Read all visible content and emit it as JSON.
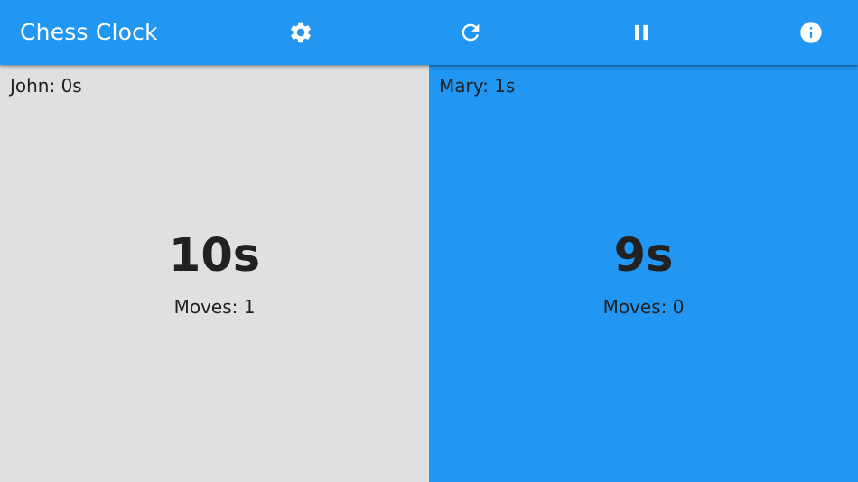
{
  "app": {
    "title": "Chess Clock",
    "accent_color": "#2196F3",
    "inactive_color": "#E0E0E0"
  },
  "toolbar": {
    "actions": [
      {
        "icon": "settings-gear-icon"
      },
      {
        "icon": "refresh-icon"
      },
      {
        "icon": "pause-icon"
      },
      {
        "icon": "info-icon"
      }
    ]
  },
  "players": [
    {
      "label": "John: 0s",
      "time": "10s",
      "moves": "Moves: 1",
      "active": false
    },
    {
      "label": "Mary: 1s",
      "time": "9s",
      "moves": "Moves: 0",
      "active": true
    }
  ]
}
